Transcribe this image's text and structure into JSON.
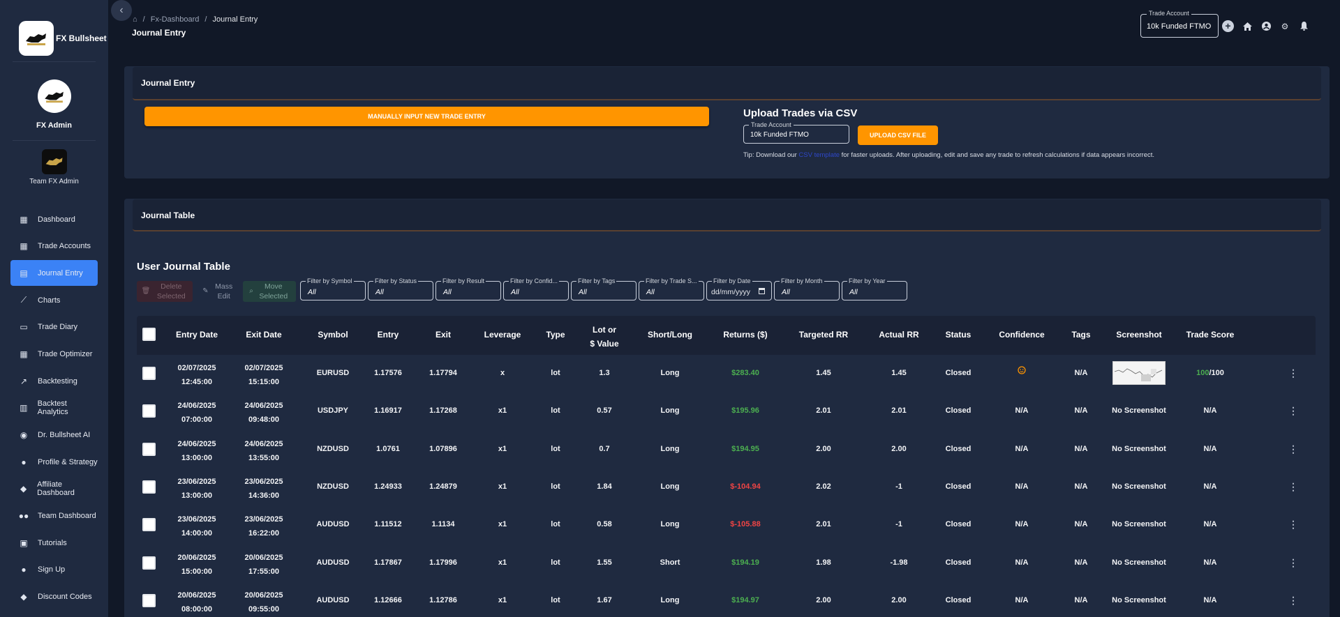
{
  "brand": {
    "name": "FX Bullsheet"
  },
  "profile": {
    "name": "FX Admin"
  },
  "team": {
    "name": "Team FX Admin"
  },
  "nav": [
    {
      "label": "Dashboard",
      "icon": "dashboard-icon"
    },
    {
      "label": "Trade Accounts",
      "icon": "dashboard-add-icon"
    },
    {
      "label": "Journal Entry",
      "icon": "journal-icon",
      "active": true
    },
    {
      "label": "Charts",
      "icon": "chart-icon"
    },
    {
      "label": "Trade Diary",
      "icon": "book-icon"
    },
    {
      "label": "Trade Optimizer",
      "icon": "grid-icon"
    },
    {
      "label": "Backtesting",
      "icon": "backtest-icon"
    },
    {
      "label": "Backtest Analytics",
      "icon": "analytics-icon"
    },
    {
      "label": "Dr. Bullsheet AI",
      "icon": "robot-icon"
    },
    {
      "label": "Profile & Strategy",
      "icon": "person-icon"
    },
    {
      "label": "Affiliate Dashboard",
      "icon": "tag-icon"
    },
    {
      "label": "Team Dashboard",
      "icon": "group-icon"
    },
    {
      "label": "Tutorials",
      "icon": "tutorials-icon"
    },
    {
      "label": "Sign Up",
      "icon": "person-add-icon"
    },
    {
      "label": "Discount Codes",
      "icon": "discount-icon"
    }
  ],
  "breadcrumb": {
    "home": "home-icon",
    "items": [
      "Fx-Dashboard",
      "Journal Entry"
    ]
  },
  "page_title": "Journal Entry",
  "top_account": {
    "label": "Trade Account",
    "value": "10k Funded FTMO"
  },
  "entry_panel": {
    "title": "Journal Entry",
    "manual_button": "MANUALLY INPUT NEW TRADE ENTRY",
    "csv_title": "Upload Trades via CSV",
    "csv_account_label": "Trade Account",
    "csv_account_value": "10k Funded FTMO",
    "csv_button": "UPLOAD CSV FILE",
    "tip_before": "Tip: Download our",
    "tip_link": "CSV template",
    "tip_after": "for faster uploads. After uploading, edit and save any trade to refresh calculations if data appears incorrect."
  },
  "table_panel": {
    "title": "Journal Table",
    "subtitle": "User Journal Table"
  },
  "actions": {
    "delete": "Delete Selected",
    "mass_edit": "Mass Edit",
    "move": "Move Selected"
  },
  "filters": [
    {
      "label": "Filter by Symbol",
      "value": "All"
    },
    {
      "label": "Filter by Status",
      "value": "All"
    },
    {
      "label": "Filter by Result",
      "value": "All"
    },
    {
      "label": "Filter by Confid...",
      "value": "All"
    },
    {
      "label": "Filter by Tags",
      "value": "All"
    },
    {
      "label": "Filter by Trade S...",
      "value": "All"
    },
    {
      "label": "Filter by Date",
      "value": "dd/mm/yyyy",
      "date": true
    },
    {
      "label": "Filter by Month",
      "value": "All"
    },
    {
      "label": "Filter by Year",
      "value": "All"
    }
  ],
  "columns": [
    "Entry Date",
    "Exit Date",
    "Symbol",
    "Entry",
    "Exit",
    "Leverage",
    "Type",
    "Lot or\n$ Value",
    "Short/Long",
    "Returns ($)",
    "Targeted RR",
    "Actual RR",
    "Status",
    "Confidence",
    "Tags",
    "Screenshot",
    "Trade Score"
  ],
  "rows": [
    {
      "entry_date": "02/07/2025\n12:45:00",
      "exit_date": "02/07/2025\n15:15:00",
      "symbol": "EURUSD",
      "entry": "1.17576",
      "exit": "1.17794",
      "leverage": "x",
      "type": "lot",
      "lot": "1.3",
      "side": "Long",
      "returns": "$283.40",
      "returns_positive": true,
      "targeted_rr": "1.45",
      "actual_rr": "1.45",
      "status": "Closed",
      "confidence": "emoji",
      "tags": "N/A",
      "screenshot": "image",
      "score_value": "100",
      "score_total": "/100"
    },
    {
      "entry_date": "24/06/2025\n07:00:00",
      "exit_date": "24/06/2025\n09:48:00",
      "symbol": "USDJPY",
      "entry": "1.16917",
      "exit": "1.17268",
      "leverage": "x1",
      "type": "lot",
      "lot": "0.57",
      "side": "Long",
      "returns": "$195.96",
      "returns_positive": true,
      "targeted_rr": "2.01",
      "actual_rr": "2.01",
      "status": "Closed",
      "confidence": "N/A",
      "tags": "N/A",
      "screenshot": "No Screenshot",
      "score": "N/A"
    },
    {
      "entry_date": "24/06/2025\n13:00:00",
      "exit_date": "24/06/2025\n13:55:00",
      "symbol": "NZDUSD",
      "entry": "1.0761",
      "exit": "1.07896",
      "leverage": "x1",
      "type": "lot",
      "lot": "0.7",
      "side": "Long",
      "returns": "$194.95",
      "returns_positive": true,
      "targeted_rr": "2.00",
      "actual_rr": "2.00",
      "status": "Closed",
      "confidence": "N/A",
      "tags": "N/A",
      "screenshot": "No Screenshot",
      "score": "N/A"
    },
    {
      "entry_date": "23/06/2025\n13:00:00",
      "exit_date": "23/06/2025\n14:36:00",
      "symbol": "NZDUSD",
      "entry": "1.24933",
      "exit": "1.24879",
      "leverage": "x1",
      "type": "lot",
      "lot": "1.84",
      "side": "Long",
      "returns": "$-104.94",
      "returns_positive": false,
      "targeted_rr": "2.02",
      "actual_rr": "-1",
      "status": "Closed",
      "confidence": "N/A",
      "tags": "N/A",
      "screenshot": "No Screenshot",
      "score": "N/A"
    },
    {
      "entry_date": "23/06/2025\n14:00:00",
      "exit_date": "23/06/2025\n16:22:00",
      "symbol": "AUDUSD",
      "entry": "1.11512",
      "exit": "1.1134",
      "leverage": "x1",
      "type": "lot",
      "lot": "0.58",
      "side": "Long",
      "returns": "$-105.88",
      "returns_positive": false,
      "targeted_rr": "2.01",
      "actual_rr": "-1",
      "status": "Closed",
      "confidence": "N/A",
      "tags": "N/A",
      "screenshot": "No Screenshot",
      "score": "N/A"
    },
    {
      "entry_date": "20/06/2025\n15:00:00",
      "exit_date": "20/06/2025\n17:55:00",
      "symbol": "AUDUSD",
      "entry": "1.17867",
      "exit": "1.17996",
      "leverage": "x1",
      "type": "lot",
      "lot": "1.55",
      "side": "Short",
      "returns": "$194.19",
      "returns_positive": true,
      "targeted_rr": "1.98",
      "actual_rr": "-1.98",
      "status": "Closed",
      "confidence": "N/A",
      "tags": "N/A",
      "screenshot": "No Screenshot",
      "score": "N/A"
    },
    {
      "entry_date": "20/06/2025\n08:00:00",
      "exit_date": "20/06/2025\n09:55:00",
      "symbol": "AUDUSD",
      "entry": "1.12666",
      "exit": "1.12786",
      "leverage": "x1",
      "type": "lot",
      "lot": "1.67",
      "side": "Long",
      "returns": "$194.97",
      "returns_positive": true,
      "targeted_rr": "2.00",
      "actual_rr": "2.00",
      "status": "Closed",
      "confidence": "N/A",
      "tags": "N/A",
      "screenshot": "No Screenshot",
      "score": "N/A"
    }
  ],
  "colors": {
    "accent": "#ff9500",
    "active_nav": "#3b82f6",
    "positive": "#4caf50",
    "negative": "#ef4444"
  }
}
